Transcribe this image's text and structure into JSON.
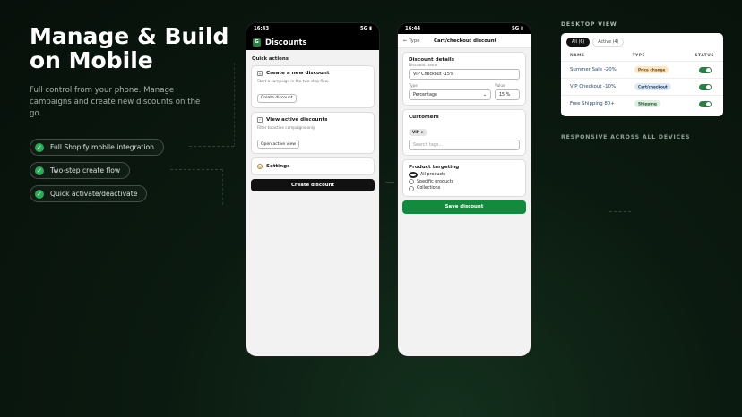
{
  "hero": {
    "title_line1": "Manage & Build",
    "title_line2": "on Mobile",
    "subtitle": "Full control from your phone. Manage campaigns and create new discounts on the go."
  },
  "features": [
    "Full Shopify mobile integration",
    "Two-step create flow",
    "Quick activate/deactivate"
  ],
  "phone1": {
    "time": "16:43",
    "signal": "5G",
    "logo_letter": "G",
    "title": "Discounts",
    "section": "Quick actions",
    "cards": [
      {
        "title": "Create a new discount",
        "desc": "Start a campaign in the two-step flow.",
        "button": "Create discount"
      },
      {
        "title": "View active discounts",
        "desc": "Filter to active campaigns only.",
        "button": "Open active view"
      },
      {
        "title": "Settings"
      }
    ],
    "cta": "Create discount"
  },
  "phone2": {
    "time": "16:44",
    "signal": "5G",
    "back": "← Type",
    "title": "Cart/checkout discount",
    "details": {
      "heading": "Discount details",
      "name_label": "Discount name",
      "name_value": "VIP Checkout -15%",
      "type_label": "Type",
      "type_value": "Percentage",
      "value_label": "Value",
      "value_value": "15 %"
    },
    "customers": {
      "heading": "Customers",
      "tag": "VIP ×",
      "search_placeholder": "Search tags..."
    },
    "targeting": {
      "heading": "Product targeting",
      "options": [
        "All products",
        "Specific products",
        "Collections"
      ]
    },
    "cta": "Save discount"
  },
  "desktop": {
    "label": "DESKTOP VIEW",
    "tabs": [
      "All (6)",
      "Active (4)"
    ],
    "headers": {
      "name": "NAME",
      "type": "TYPE",
      "status": "STATUS"
    },
    "rows": [
      {
        "name": "Summer Sale -20%",
        "type": "Price change",
        "badge_bg": "#fbe7c6",
        "badge_fg": "#7a4a10"
      },
      {
        "name": "VIP Checkout -10%",
        "type": "Cart/checkout",
        "badge_bg": "#dfe9f5",
        "badge_fg": "#1f3a5a"
      },
      {
        "name": "Free Shipping 80+",
        "type": "Shipping",
        "badge_bg": "#dff0e3",
        "badge_fg": "#1d5a30"
      }
    ],
    "responsive_label": "RESPONSIVE ACROSS ALL DEVICES"
  },
  "colors": {
    "accent_green": "#138a3e",
    "check_green": "#2fa85a",
    "toggle_green": "#2f7d46"
  }
}
